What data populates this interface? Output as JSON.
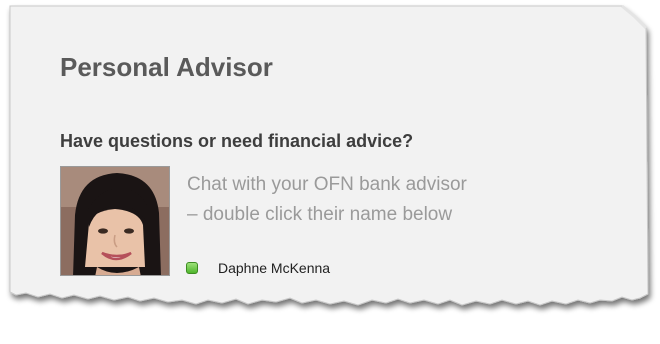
{
  "widget": {
    "title": "Personal Advisor",
    "question": "Have questions or need financial advice?",
    "chat_line_1": "Chat with your OFN bank advisor",
    "chat_line_2": "– double click their name below",
    "advisor": {
      "name": "Daphne McKenna",
      "status": "online",
      "status_color": "#5cc033"
    }
  },
  "colors": {
    "panel_background": "#f2f2f2",
    "title_text": "#5a5a5a",
    "muted_text": "#9a9a9a"
  }
}
